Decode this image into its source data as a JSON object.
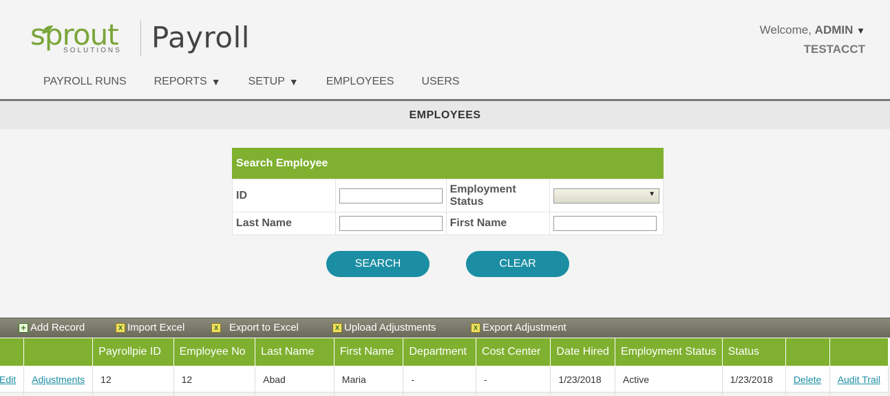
{
  "brand": {
    "logo_word": "sprout",
    "logo_sub": "SOLUTIONS",
    "app_title": "Payroll",
    "accent": "#7fb02f",
    "button_color": "#1c8ea3"
  },
  "header": {
    "welcome_prefix": "Welcome,",
    "user": "ADMIN",
    "account": "TESTACCT"
  },
  "nav": {
    "items": [
      {
        "label": "PAYROLL RUNS"
      },
      {
        "label": "REPORTS"
      },
      {
        "label": "SETUP"
      },
      {
        "label": "EMPLOYEES"
      },
      {
        "label": "USERS"
      }
    ]
  },
  "page": {
    "title": "EMPLOYEES"
  },
  "search": {
    "heading": "Search Employee",
    "id_label": "ID",
    "employment_status_label": "Employment Status",
    "last_name_label": "Last Name",
    "first_name_label": "First Name",
    "id_value": "",
    "last_name_value": "",
    "first_name_value": "",
    "employment_status_value": "",
    "search_button": "SEARCH",
    "clear_button": "CLEAR"
  },
  "toolbar": {
    "add_record": "Add Record",
    "import_excel": "Import Excel",
    "export_excel": "Export to Excel",
    "upload_adjustments": "Upload Adjustments",
    "export_adjustment": "Export Adjustment"
  },
  "grid": {
    "columns": [
      "",
      "",
      "Payrollpie ID",
      "Employee No",
      "Last Name",
      "First Name",
      "Department",
      "Cost Center",
      "Date Hired",
      "Employment Status",
      "Status",
      "",
      ""
    ],
    "rows": [
      {
        "edit": "Edit",
        "adjustments": "Adjustments",
        "payrollpie_id": "12",
        "employee_no": "12",
        "last_name": "Abad",
        "first_name": "Maria",
        "department": "-",
        "cost_center": "-",
        "date_hired": "1/23/2018",
        "employment_status": "Active",
        "status": "1/23/2018",
        "delete": "Delete",
        "audit_trail": "Audit Trail"
      }
    ]
  }
}
